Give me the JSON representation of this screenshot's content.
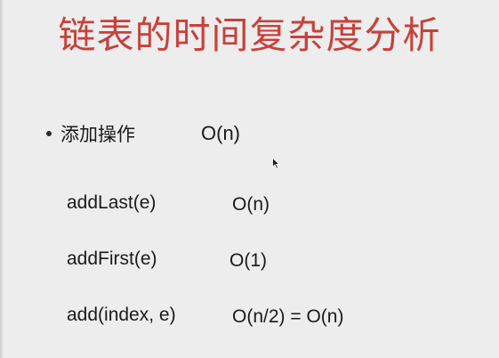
{
  "slide": {
    "title": "链表的时间复杂度分析",
    "bullet": {
      "label": "添加操作",
      "value": "O(n)"
    },
    "operations": [
      {
        "name": "addLast(e)",
        "complexity": "O(n)"
      },
      {
        "name": "addFirst(e)",
        "complexity": "O(1)"
      },
      {
        "name": "add(index, e)",
        "complexity": "O(n/2) = O(n)"
      }
    ]
  },
  "icons": {
    "pointer": "mouse-pointer-icon",
    "bullet": "bullet-dot-icon"
  },
  "colors": {
    "title": "#c8413b",
    "background": "#ededed",
    "text": "#1a1a1a"
  }
}
